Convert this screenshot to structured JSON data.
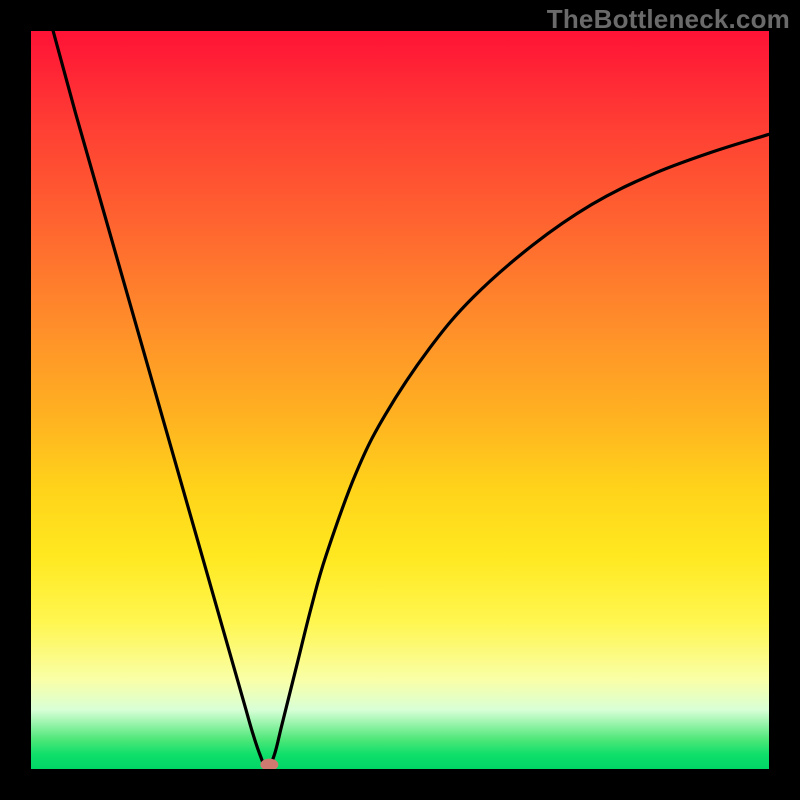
{
  "watermark": "TheBottleneck.com",
  "chart_data": {
    "type": "line",
    "title": "",
    "xlabel": "",
    "ylabel": "",
    "xlim": [
      0,
      100
    ],
    "ylim": [
      0,
      100
    ],
    "series": [
      {
        "name": "bottleneck-curve",
        "x": [
          3,
          6,
          10,
          14,
          18,
          22,
          24,
          26,
          28,
          29,
          30,
          31,
          32,
          33,
          34,
          36,
          38,
          40,
          44,
          48,
          54,
          60,
          68,
          76,
          84,
          92,
          100
        ],
        "values": [
          100,
          89,
          75,
          61,
          47,
          33,
          26,
          19,
          12,
          8.5,
          5,
          2,
          0,
          2,
          6,
          14,
          22,
          29,
          40,
          48,
          57,
          64,
          71,
          76.5,
          80.5,
          83.5,
          86
        ]
      }
    ],
    "marker": {
      "x": 32.3,
      "y": 0.6,
      "color": "#cf7a70"
    },
    "background_gradient": {
      "top": "#ff1236",
      "mid": "#ffd31a",
      "bottom": "#00d666"
    }
  }
}
